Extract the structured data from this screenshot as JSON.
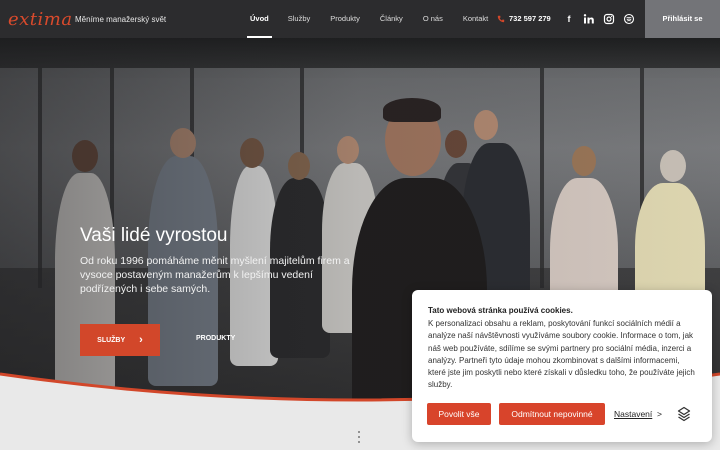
{
  "header": {
    "logo": "extima",
    "tagline": "Měníme manažerský svět",
    "nav": [
      "Úvod",
      "Služby",
      "Produkty",
      "Články",
      "O nás",
      "Kontakt"
    ],
    "active_nav": "Úvod",
    "phone": "732 597 279",
    "social_icons": [
      "facebook-icon",
      "linkedin-icon",
      "instagram-icon",
      "podcast-icon"
    ],
    "login": "Přihlásit se"
  },
  "hero": {
    "title": "Vaši lidé vyrostou",
    "text": "Od roku 1996 pomáháme měnit myšlení majitelům firem a vysoce postaveným manažerům k lepšímu vedení podřízených i sebe samých.",
    "primary_button": "SLUŽBY",
    "primary_button_arrow": "›",
    "secondary_button": "PRODUKTY"
  },
  "cookie": {
    "title": "Tato webová stránka používá cookies.",
    "text": "K personalizaci obsahu a reklam, poskytování funkcí sociálních médií a analýze naší návštěvnosti využíváme soubory cookie. Informace o tom, jak náš web používáte, sdílíme se svými partnery pro sociální média, inzerci a analýzy. Partneři tyto údaje mohou zkombinovat s dalšími informacemi, které jste jim poskytli nebo které získali v důsledku toho, že používáte jejich služby.",
    "allow_button": "Povolit vše",
    "reject_button": "Odmítnout nepovinné",
    "settings_link": "Nastavení",
    "settings_arrow": ">"
  },
  "colors": {
    "accent": "#d2472a",
    "header_bg": "#2c2c2e",
    "login_bg": "#737478"
  }
}
